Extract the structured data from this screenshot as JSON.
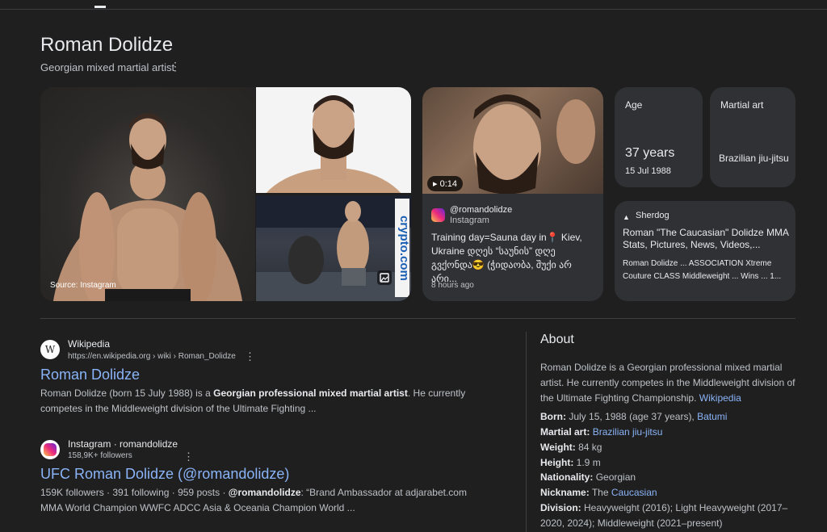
{
  "header": {
    "title": "Roman Dolidze",
    "subtitle": "Georgian mixed martial artist"
  },
  "images": {
    "main_caption": "Source: Instagram",
    "sign_text": "crypto.com",
    "sign_color": "#1a5fb4"
  },
  "instagram_card": {
    "duration": "▸ 0:14",
    "handle": "@romandolidze",
    "source": "Instagram",
    "text": "Training day=Sauna day in📍 Kiev, Ukraine დღეს “საუნის” დღე გვქონდა😎 (ჭიდაობა, შუქი არ არი...",
    "time": "8 hours ago"
  },
  "facts": {
    "age": {
      "label": "Age",
      "value": "37 years",
      "date": "15 Jul 1988"
    },
    "martial_art": {
      "label": "Martial art",
      "value": "Brazilian jiu-jitsu"
    }
  },
  "sherdog": {
    "source": "Sherdog",
    "title": "Roman \"The Caucasian\" Dolidze MMA Stats, Pictures, News, Videos,...",
    "snippet": "Roman Dolidze ... ASSOCIATION Xtreme Couture CLASS Middleweight ... Wins ... 1..."
  },
  "results": [
    {
      "site": "Wikipedia",
      "url": "https://en.wikipedia.org › wiki › Roman_Dolidze",
      "title": "Roman Dolidze",
      "snippet_a": "Roman Dolidze (born 15 July 1988) is a ",
      "snippet_bold": "Georgian professional mixed martial artist",
      "snippet_b": ". He currently competes in the Middleweight division of the Ultimate Fighting ..."
    },
    {
      "site": "Instagram · romandolidze",
      "url": "158,9K+ followers",
      "title": "UFC Roman Dolidze (@romandolidze)",
      "snippet_a": "159K followers · 391 following · 959 posts · ",
      "snippet_bold": "@romandolidze",
      "snippet_b": ": “Brand Ambassador at adjarabet.com MMA World Champion WWFC ADCC Asia & Oceania Champion World ..."
    }
  ],
  "about": {
    "heading": "About",
    "text": "Roman Dolidze is a Georgian professional mixed martial artist. He currently competes in the Middleweight division of the Ultimate Fighting Championship.",
    "text_link": "Wikipedia",
    "born_key": "Born:",
    "born_val": "July 15, 1988 (age 37 years),",
    "born_link": "Batumi",
    "art_key": "Martial art:",
    "art_link": "Brazilian jiu-jitsu",
    "weight_key": "Weight:",
    "weight_val": "84 kg",
    "height_key": "Height:",
    "height_val": "1.9 m",
    "nat_key": "Nationality:",
    "nat_val": "Georgian",
    "nick_key": "Nickname:",
    "nick_val": "The",
    "nick_link": "Caucasian",
    "div_key": "Division:",
    "div_val": "Heavyweight (2016); Light Heavyweight (2017–2020, 2024); Middleweight (2021–present)"
  }
}
